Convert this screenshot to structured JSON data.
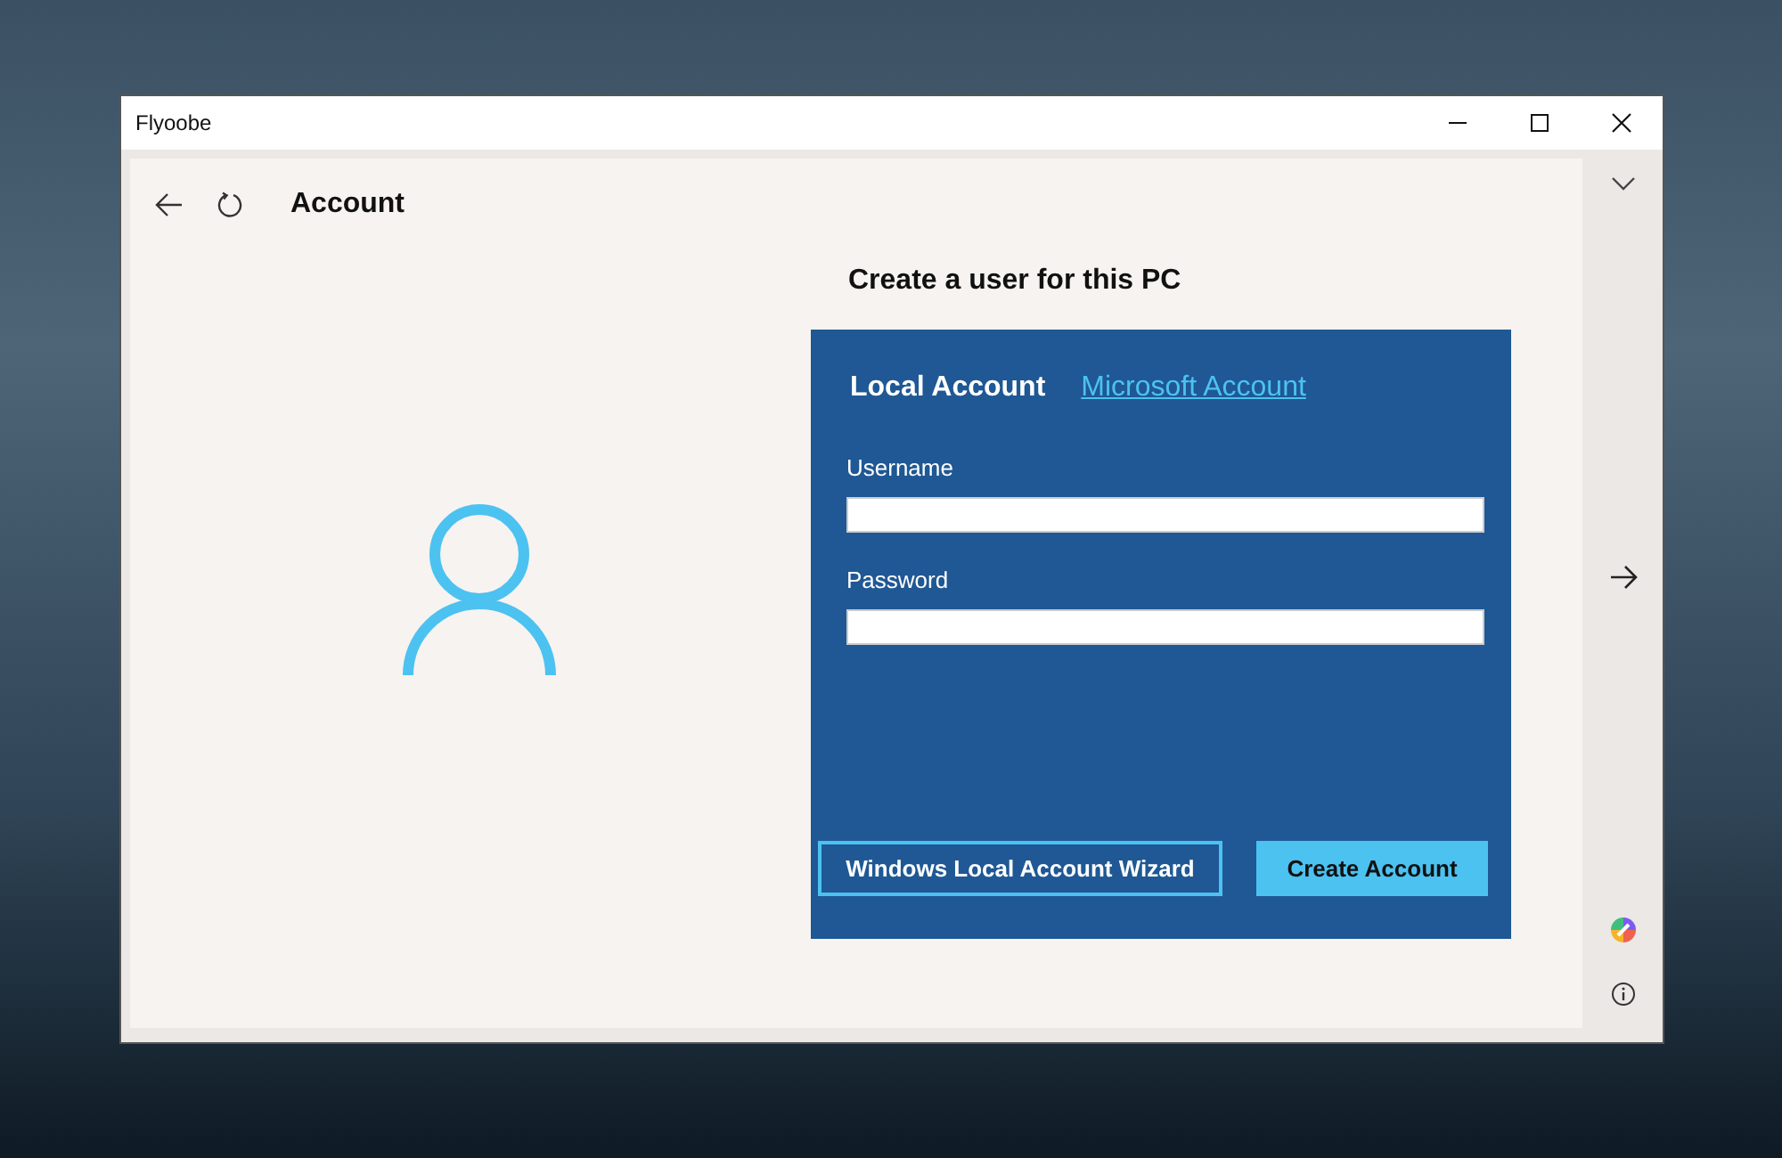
{
  "window": {
    "title": "Flyoobe"
  },
  "header": {
    "title": "Account"
  },
  "form": {
    "heading": "Create a user for this PC",
    "tabs": [
      {
        "label": "Local Account",
        "selected": true
      },
      {
        "label": "Microsoft Account",
        "selected": false
      }
    ],
    "fields": [
      {
        "label": "Username"
      },
      {
        "label": "Password"
      }
    ],
    "buttons": [
      {
        "label": "Windows Local Account Wizard",
        "kind": "outline"
      },
      {
        "label": "Create Account",
        "kind": "primary"
      }
    ]
  }
}
